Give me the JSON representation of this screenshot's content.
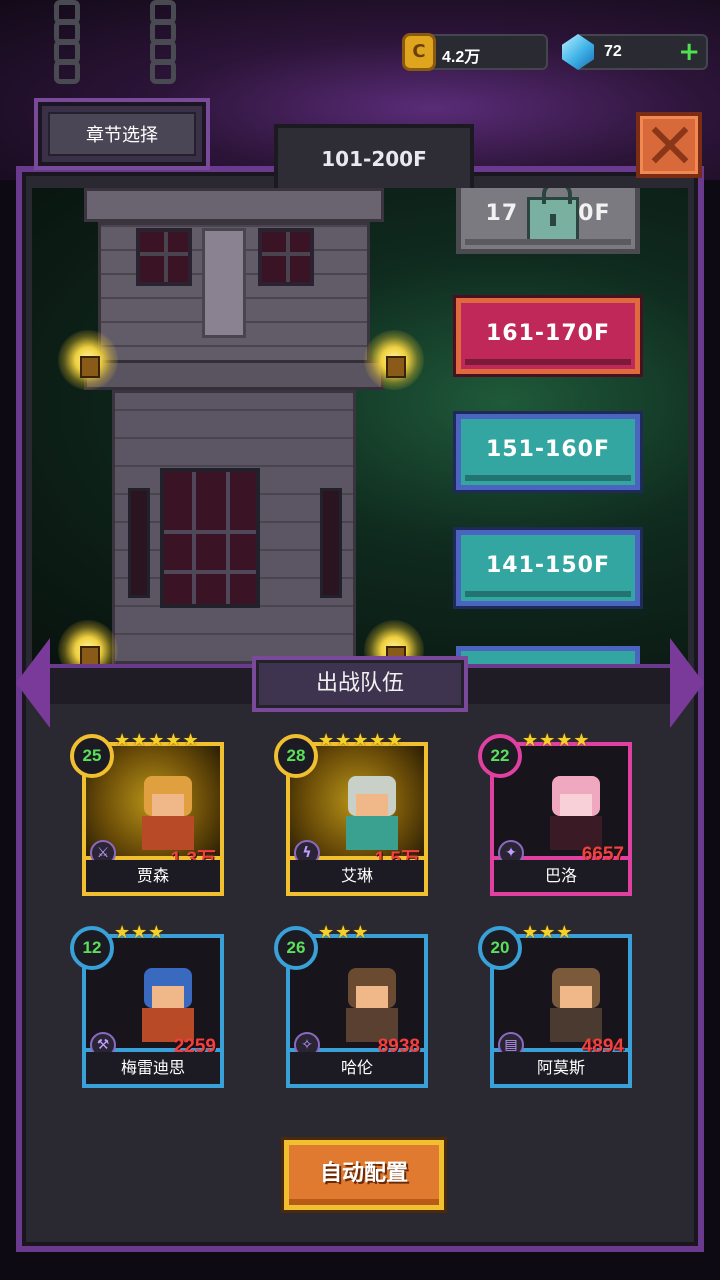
{
  "currency": {
    "coins": "4.2万",
    "gems": "72",
    "coin_icon": "coin-icon",
    "gem_icon": "gem-icon",
    "plus_icon": "plus-icon"
  },
  "chapter_select": {
    "label": "章节选择"
  },
  "range_tab": {
    "label": "101-200F"
  },
  "floors": [
    {
      "label": "17",
      "label_end": "0F",
      "state": "locked",
      "icon": "lock-icon"
    },
    {
      "label": "161-170F",
      "state": "current",
      "color": "#c0285a"
    },
    {
      "label": "151-160F",
      "state": "cleared",
      "color": "#34a6a2"
    },
    {
      "label": "141-150F",
      "state": "cleared",
      "color": "#34a6a2"
    }
  ],
  "team": {
    "title": "出战队伍",
    "heroes": [
      {
        "name": "贾森",
        "level": "25",
        "stars": "★★★★★",
        "power": "1.3万",
        "frame": "gold"
      },
      {
        "name": "艾琳",
        "level": "28",
        "stars": "★★★★★",
        "power": "1.5万",
        "frame": "gold"
      },
      {
        "name": "巴洛",
        "level": "22",
        "stars": "★★★★",
        "power": "6657",
        "frame": "pink"
      },
      {
        "name": "梅雷迪思",
        "level": "12",
        "stars": "★★★",
        "power": "2259",
        "frame": "blue"
      },
      {
        "name": "哈伦",
        "level": "26",
        "stars": "★★★",
        "power": "8938",
        "frame": "blue"
      },
      {
        "name": "阿莫斯",
        "level": "20",
        "stars": "★★★",
        "power": "4894",
        "frame": "blue"
      }
    ]
  },
  "auto_button": {
    "label": "自动配置"
  },
  "colors": {
    "panel_border": "#6a3a8e",
    "gold_frame": "#f0c030",
    "pink_frame": "#e040a0",
    "blue_frame": "#3aa0d8",
    "level_text": "#5ae05a",
    "power_text": "#f04040"
  }
}
